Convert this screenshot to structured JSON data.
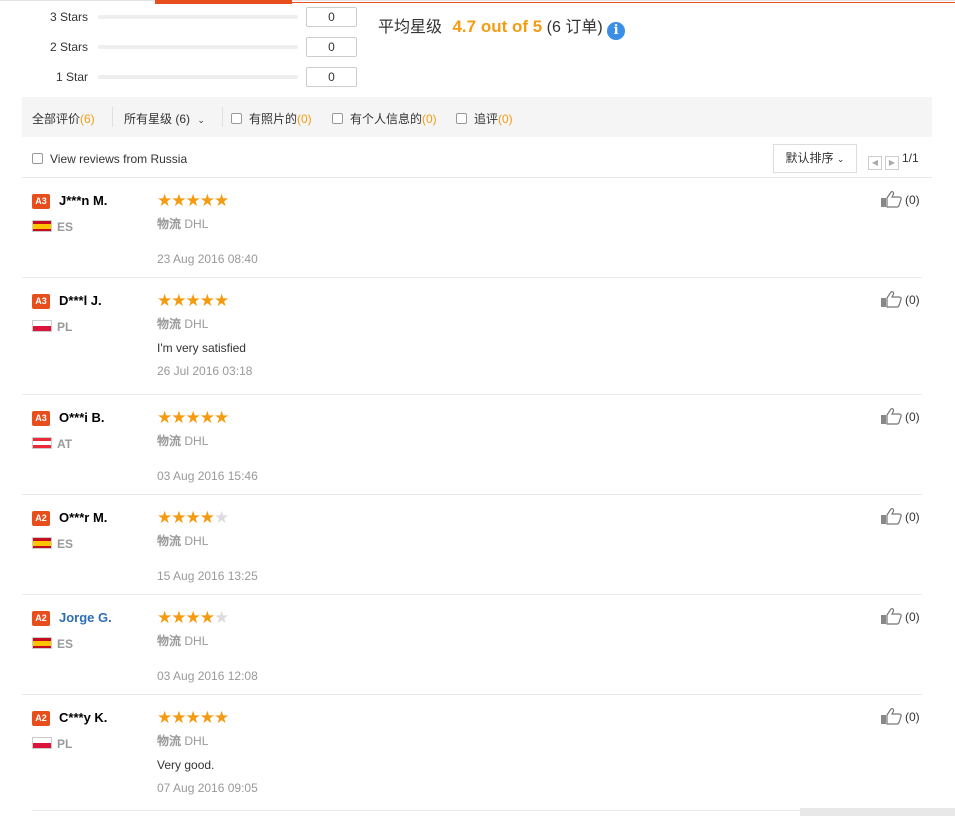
{
  "star_breakdown": [
    {
      "label": "3 Stars",
      "count": "0"
    },
    {
      "label": "2 Stars",
      "count": "0"
    },
    {
      "label": "1 Star",
      "count": "0"
    }
  ],
  "average": {
    "label": "平均星级",
    "rating": "4.7 out of 5",
    "orders": "(6 订单)",
    "info_icon": "i"
  },
  "filters": {
    "all_label": "全部评价",
    "all_count": "(6)",
    "stars_label": "所有星级 (6)",
    "photos_label": "有照片的",
    "photos_count": "(0)",
    "personal_label": "有个人信息的",
    "personal_count": "(0)",
    "followup_label": "追评",
    "followup_count": "(0)"
  },
  "russia_filter": "View reviews from Russia",
  "sort_label": "默认排序",
  "pager_text": "1/1",
  "logistics_key": "物流",
  "reviews": [
    {
      "badge": "A3",
      "name": "J***n M.",
      "country": "ES",
      "stars": 5,
      "logistics": "DHL",
      "feedback": "",
      "date": "23 Aug 2016 08:40",
      "likes": "(0)"
    },
    {
      "badge": "A3",
      "name": "D***l J.",
      "country": "PL",
      "stars": 5,
      "logistics": "DHL",
      "feedback": "I'm very satisfied",
      "date": "26 Jul 2016 03:18",
      "likes": "(0)"
    },
    {
      "badge": "A3",
      "name": "O***i B.",
      "country": "AT",
      "stars": 5,
      "logistics": "DHL",
      "feedback": "",
      "date": "03 Aug 2016 15:46",
      "likes": "(0)"
    },
    {
      "badge": "A2",
      "name": "O***r M.",
      "country": "ES",
      "stars": 4,
      "logistics": "DHL",
      "feedback": "",
      "date": "15 Aug 2016 13:25",
      "likes": "(0)"
    },
    {
      "badge": "A2",
      "name": "Jorge G.",
      "country": "ES",
      "stars": 4,
      "logistics": "DHL",
      "feedback": "",
      "date": "03 Aug 2016 12:08",
      "likes": "(0)"
    },
    {
      "badge": "A2",
      "name": "C***y K.",
      "country": "PL",
      "stars": 5,
      "logistics": "DHL",
      "feedback": "Very good.",
      "date": "07 Aug 2016 09:05",
      "likes": "(0)"
    }
  ],
  "colors": {
    "accent": "#e84d1c",
    "star": "#f39c12",
    "link": "#2d6db5"
  }
}
